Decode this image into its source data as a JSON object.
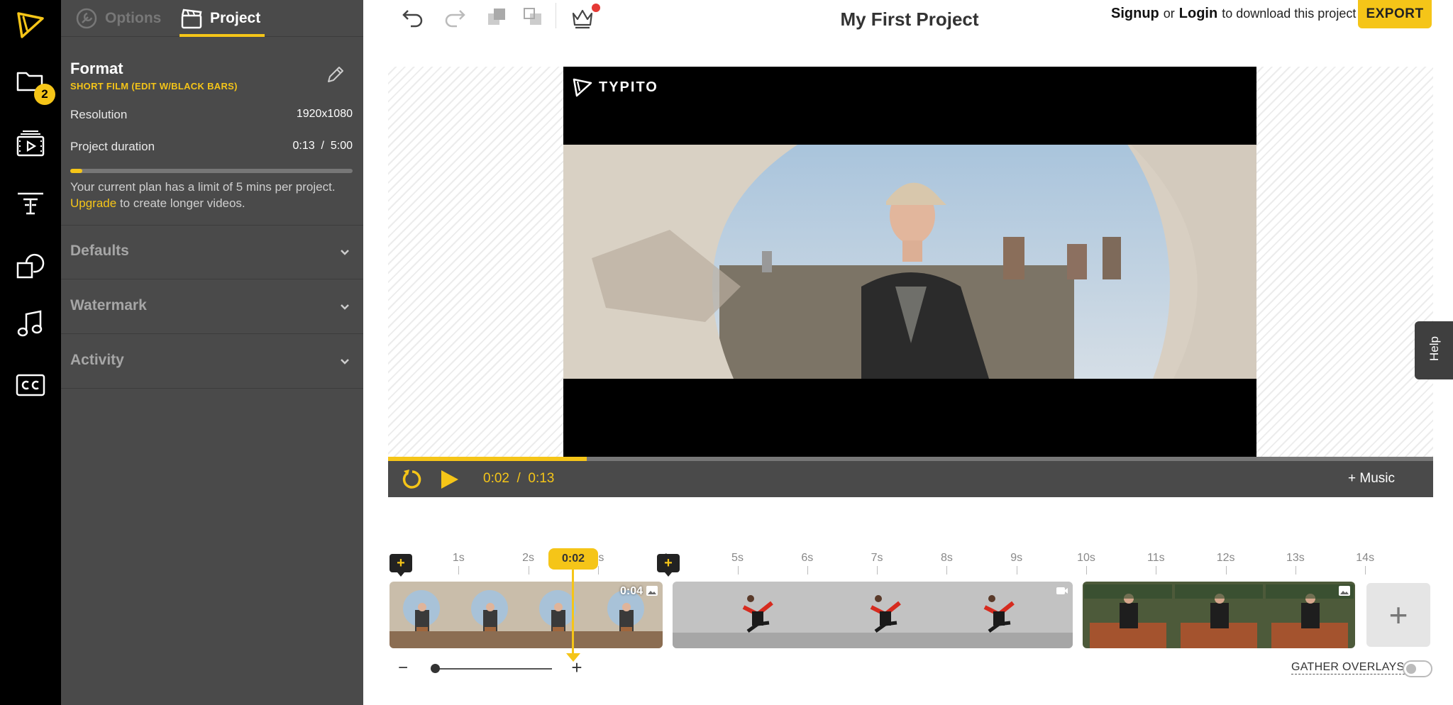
{
  "app": {
    "name": "Typito"
  },
  "sidebar": {
    "media_badge": "2",
    "items": [
      {
        "name": "media",
        "icon": "folder-icon"
      },
      {
        "name": "scenes",
        "icon": "video-scenes-icon"
      },
      {
        "name": "text",
        "icon": "text-icon"
      },
      {
        "name": "shapes",
        "icon": "shapes-icon"
      },
      {
        "name": "music",
        "icon": "music-note-icon"
      },
      {
        "name": "captions",
        "icon": "cc-icon"
      }
    ]
  },
  "panel": {
    "tabs": [
      {
        "label": "Options",
        "icon": "wrench-icon",
        "active": false
      },
      {
        "label": "Project",
        "icon": "clapperboard-icon",
        "active": true
      }
    ],
    "format": {
      "title": "Format",
      "subtitle": "SHORT FILM (EDIT W/BLACK BARS)",
      "resolution_label": "Resolution",
      "resolution_value": "1920x1080",
      "duration_label": "Project duration",
      "duration_value": "0:13  /  5:00",
      "duration_fraction": 0.043,
      "plan_note_prefix": "Your current plan has a limit of 5 mins per project.",
      "upgrade_link": "Upgrade",
      "plan_note_suffix": " to create longer videos."
    },
    "sections": [
      "Defaults",
      "Watermark",
      "Activity"
    ]
  },
  "toolbar": {
    "icons": [
      "undo-icon",
      "redo-icon",
      "bring-forward-icon",
      "send-backward-icon",
      "crown-icon"
    ],
    "project_title": "My First Project",
    "signup": "Signup",
    "or": "or",
    "login": "Login",
    "download_note": "to download this project",
    "export": "EXPORT"
  },
  "preview": {
    "watermark": "TYPITO",
    "help": "Help"
  },
  "player": {
    "current_time": "0:02",
    "total_time": "0:13",
    "time_display": "0:02  /  0:13",
    "progress_fraction": 0.19,
    "music_button": "+ Music"
  },
  "timeline": {
    "ruler": [
      "1s",
      "2s",
      "3s",
      "4s",
      "5s",
      "6s",
      "7s",
      "8s",
      "9s",
      "10s",
      "11s",
      "12s",
      "13s",
      "14s"
    ],
    "playhead": "0:02",
    "clips": [
      {
        "duration": "0:04",
        "type": "image-icon",
        "subject": "man-seated-on-wall"
      },
      {
        "duration": "",
        "type": "video-icon",
        "subject": "breakdancer"
      },
      {
        "duration": "",
        "type": "image-icon",
        "subject": "man-on-bench"
      }
    ],
    "add_clip": "+",
    "zoom_minus": "−",
    "zoom_plus": "+",
    "zoom_level": 0.03,
    "gather_overlays": "GATHER OVERLAYS",
    "gather_overlays_on": false
  },
  "colors": {
    "accent": "#f5c518",
    "rail": "#000000",
    "panel": "#4a4a4a",
    "player": "#4a4a4a"
  }
}
